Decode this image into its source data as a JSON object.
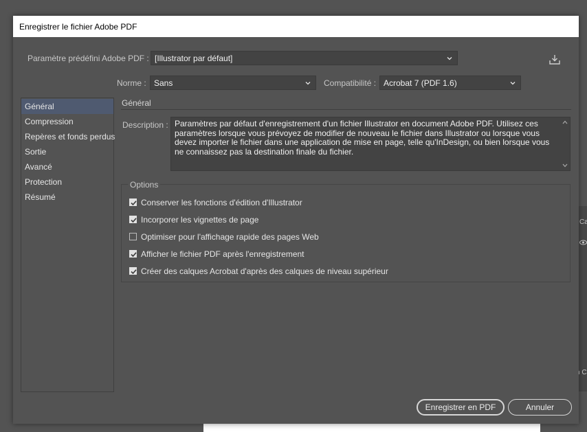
{
  "background": {
    "fragment_top": "Ca",
    "fragment_bottom": "n C"
  },
  "dialog": {
    "title": "Enregistrer le fichier Adobe PDF"
  },
  "preset": {
    "label": "Paramètre prédéfini Adobe PDF :",
    "value": "[Illustrator par défaut]",
    "save_icon": "save-preset-icon"
  },
  "standard": {
    "label": "Norme :",
    "value": "Sans"
  },
  "compatibility": {
    "label": "Compatibilité :",
    "value": "Acrobat 7 (PDF 1.6)"
  },
  "sidebar": {
    "items": [
      {
        "label": "Général",
        "selected": true
      },
      {
        "label": "Compression",
        "selected": false
      },
      {
        "label": "Repères et fonds perdus",
        "selected": false
      },
      {
        "label": "Sortie",
        "selected": false
      },
      {
        "label": "Avancé",
        "selected": false
      },
      {
        "label": "Protection",
        "selected": false
      },
      {
        "label": "Résumé",
        "selected": false
      }
    ]
  },
  "main": {
    "section_title": "Général",
    "description_label": "Description :",
    "description": "Paramètres par défaut d'enregistrement d'un fichier Illustrator en document Adobe PDF. Utilisez ces paramètres lorsque vous prévoyez de modifier de nouveau le fichier dans Illustrator ou lorsque vous devez importer le fichier dans une application de mise en page, telle qu'InDesign, ou bien lorsque vous ne connaissez pas la destination finale du fichier.",
    "options_title": "Options",
    "options": [
      {
        "label": "Conserver les fonctions d'édition d'Illustrator",
        "checked": true
      },
      {
        "label": "Incorporer les vignettes de page",
        "checked": true
      },
      {
        "label": "Optimiser pour l'affichage rapide des pages Web",
        "checked": false
      },
      {
        "label": "Afficher le fichier PDF après l'enregistrement",
        "checked": true
      },
      {
        "label": "Créer des calques Acrobat d'après des calques de niveau supérieur",
        "checked": true
      }
    ]
  },
  "buttons": {
    "save_label": "Enregistrer en PDF",
    "cancel_label": "Annuler"
  },
  "colors": {
    "dialog_bg": "#535353",
    "selected_item": "#4f5a70",
    "field_bg": "#434343"
  }
}
